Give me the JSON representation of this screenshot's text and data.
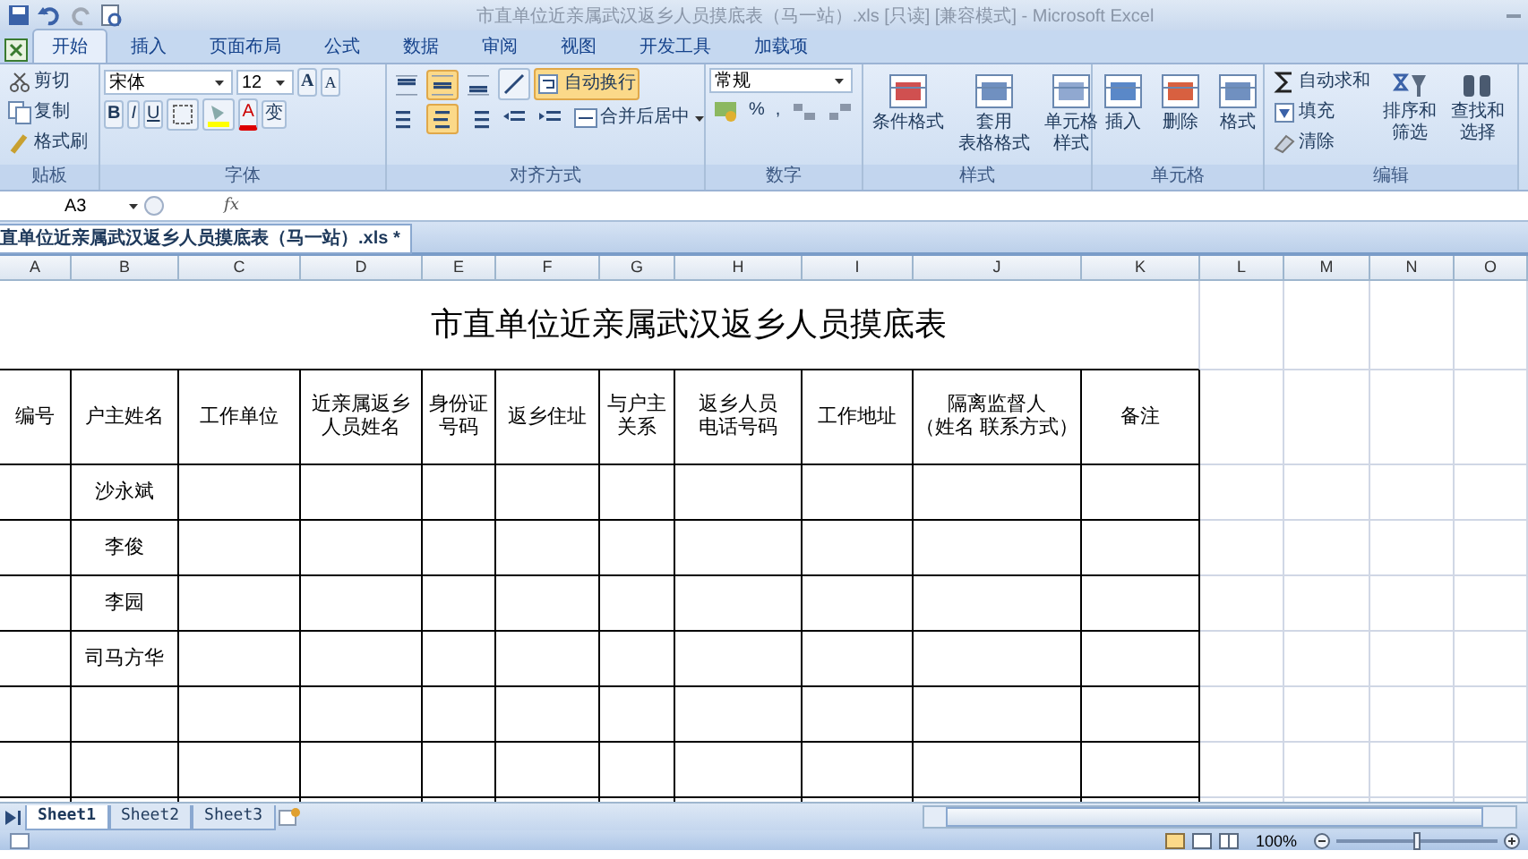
{
  "window": {
    "title": "市直单位近亲属武汉返乡人员摸底表（马一站）.xls  [只读]  [兼容模式] - Microsoft Excel"
  },
  "ribbon_tabs": [
    {
      "label": "开始",
      "selected": true
    },
    {
      "label": "插入",
      "selected": false
    },
    {
      "label": "页面布局",
      "selected": false
    },
    {
      "label": "公式",
      "selected": false
    },
    {
      "label": "数据",
      "selected": false
    },
    {
      "label": "审阅",
      "selected": false
    },
    {
      "label": "视图",
      "selected": false
    },
    {
      "label": "开发工具",
      "selected": false
    },
    {
      "label": "加载项",
      "selected": false
    }
  ],
  "clipboard": {
    "label": "贴板",
    "items": [
      "剪切",
      "复制",
      "格式刷"
    ]
  },
  "font": {
    "label": "字体",
    "name": "宋体",
    "size": "12",
    "grow": "A",
    "shrink": "A",
    "bold": "B",
    "italic": "I",
    "underline": "U",
    "font_color_label": "A",
    "phonetic": "变"
  },
  "alignment": {
    "label": "对齐方式",
    "vertical": [
      {
        "selected": false
      },
      {
        "selected": true
      },
      {
        "selected": false
      }
    ],
    "horizontal": [
      {
        "selected": false
      },
      {
        "selected": true
      },
      {
        "selected": false
      }
    ],
    "wrap": {
      "label": "自动换行",
      "selected": true
    },
    "merge": "合并后居中"
  },
  "number": {
    "label": "数字",
    "format": "常规",
    "percent": "%",
    "comma": ","
  },
  "styles": {
    "label": "样式",
    "items": [
      [
        "条件格式"
      ],
      [
        "套用",
        "表格格式"
      ],
      [
        "单元格",
        "样式"
      ]
    ]
  },
  "cells": {
    "label": "单元格",
    "items": [
      "插入",
      "删除",
      "格式"
    ]
  },
  "editing": {
    "label": "编辑",
    "autosum": "自动求和",
    "fill": "填充",
    "clear": "清除",
    "sort": [
      "排序和",
      "筛选"
    ],
    "find": [
      "查找和",
      "选择"
    ]
  },
  "formula_bar": {
    "name_box": "A3",
    "fx": "fx"
  },
  "document_tab": "直单位近亲属武汉返乡人员摸底表（马一站）.xls *",
  "sheet": {
    "columns": [
      "A",
      "B",
      "C",
      "D",
      "E",
      "F",
      "G",
      "H",
      "I",
      "J",
      "K",
      "L",
      "M",
      "N",
      "O"
    ],
    "title": "市直单位近亲属武汉返乡人员摸底表",
    "headers": [
      [
        "编号"
      ],
      [
        "户主姓名"
      ],
      [
        "工作单位"
      ],
      [
        "近亲属返乡",
        "人员姓名"
      ],
      [
        "身份证",
        "号码"
      ],
      [
        "返乡住址"
      ],
      [
        "与户主",
        "关系"
      ],
      [
        "返乡人员",
        "电话号码"
      ],
      [
        "工作地址"
      ],
      [
        "隔离监督人",
        "（姓名  联系方式）"
      ],
      [
        "备注"
      ]
    ],
    "rows": [
      {
        "household_head": "沙永斌"
      },
      {
        "household_head": "李俊"
      },
      {
        "household_head": "李园"
      },
      {
        "household_head": "司马方华"
      }
    ]
  },
  "sheet_tabs": [
    {
      "label": "Sheet1",
      "selected": true
    },
    {
      "label": "Sheet2",
      "selected": false
    },
    {
      "label": "Sheet3",
      "selected": false
    }
  ],
  "status_bar": {
    "zoom": "100%"
  },
  "zoom_slider": {
    "level": 0.5
  }
}
